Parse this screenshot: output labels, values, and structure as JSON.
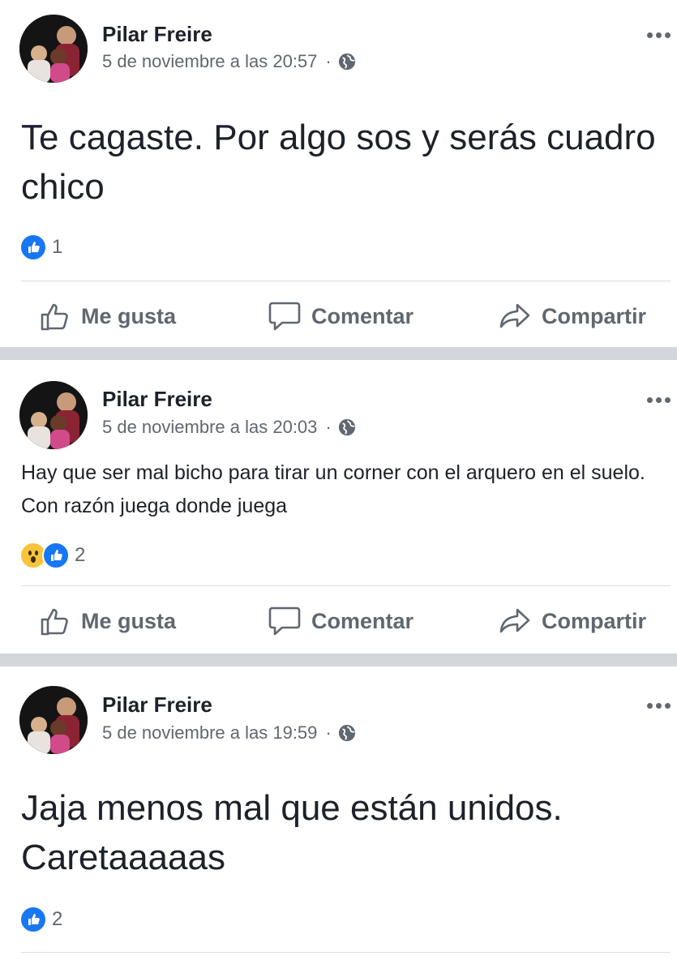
{
  "posts": [
    {
      "author": "Pilar Freire",
      "timestamp": "5 de noviembre a las 20:57",
      "privacy_separator": "·",
      "privacy_icon": "globe-icon",
      "text": "Te cagaste. Por algo sos y serás cuadro chico",
      "reactions": [
        "like"
      ],
      "reaction_count": "1"
    },
    {
      "author": "Pilar Freire",
      "timestamp": "5 de noviembre a las 20:03",
      "privacy_separator": "·",
      "privacy_icon": "globe-icon",
      "text": "Hay que ser mal bicho para tirar un corner con el arquero en el suelo. Con razón juega donde juega",
      "reactions": [
        "wow",
        "like"
      ],
      "reaction_count": "2"
    },
    {
      "author": "Pilar Freire",
      "timestamp": "5 de noviembre a las 19:59",
      "privacy_separator": "·",
      "privacy_icon": "globe-icon",
      "text": "Jaja menos mal que están unidos. Caretaaaaas",
      "reactions": [
        "like"
      ],
      "reaction_count": "2"
    }
  ],
  "actions": {
    "like_label": "Me gusta",
    "comment_label": "Comentar",
    "share_label": "Compartir"
  },
  "colors": {
    "like_blue": "#1877f2",
    "wow_yellow": "#f7c43a",
    "action_gray": "#606770",
    "separator": "#d3d6db"
  }
}
